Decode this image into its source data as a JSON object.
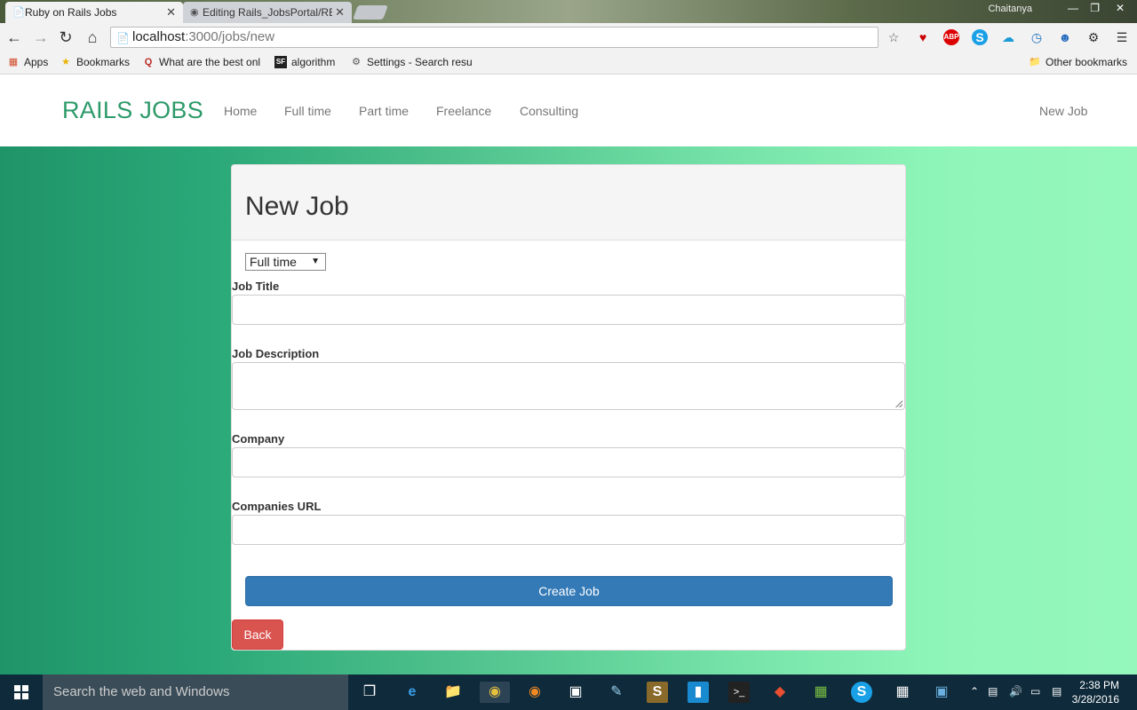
{
  "browser": {
    "tabs": [
      {
        "title": "Ruby on Rails Jobs",
        "active": true
      },
      {
        "title": "Editing Rails_JobsPortal/RE",
        "active": false
      }
    ],
    "user": "Chaitanya",
    "url_host": "localhost",
    "url_path": ":3000/jobs/new",
    "bookmarks": [
      {
        "label": "Apps",
        "icon": "apps-grid-icon"
      },
      {
        "label": "Bookmarks",
        "icon": "star-icon"
      },
      {
        "label": "What are the best onl",
        "icon": "quora-icon"
      },
      {
        "label": "algorithm",
        "icon": "sf-icon"
      },
      {
        "label": "Settings - Search resu",
        "icon": "gear-icon"
      }
    ],
    "other_bookmarks": "Other bookmarks"
  },
  "navbar": {
    "brand": "RAILS JOBS",
    "links": [
      "Home",
      "Full time",
      "Part time",
      "Freelance",
      "Consulting"
    ],
    "new_job": "New Job"
  },
  "form": {
    "heading": "New Job",
    "job_type_selected": "Full time",
    "labels": {
      "title": "Job Title",
      "description": "Job Description",
      "company": "Company",
      "url": "Companies URL"
    },
    "submit": "Create Job",
    "back": "Back"
  },
  "taskbar": {
    "search_placeholder": "Search the web and Windows",
    "time": "2:38 PM",
    "date": "3/28/2016"
  },
  "colors": {
    "brand": "#2d9a6a",
    "primary": "#337ab7",
    "danger": "#d9534f"
  }
}
